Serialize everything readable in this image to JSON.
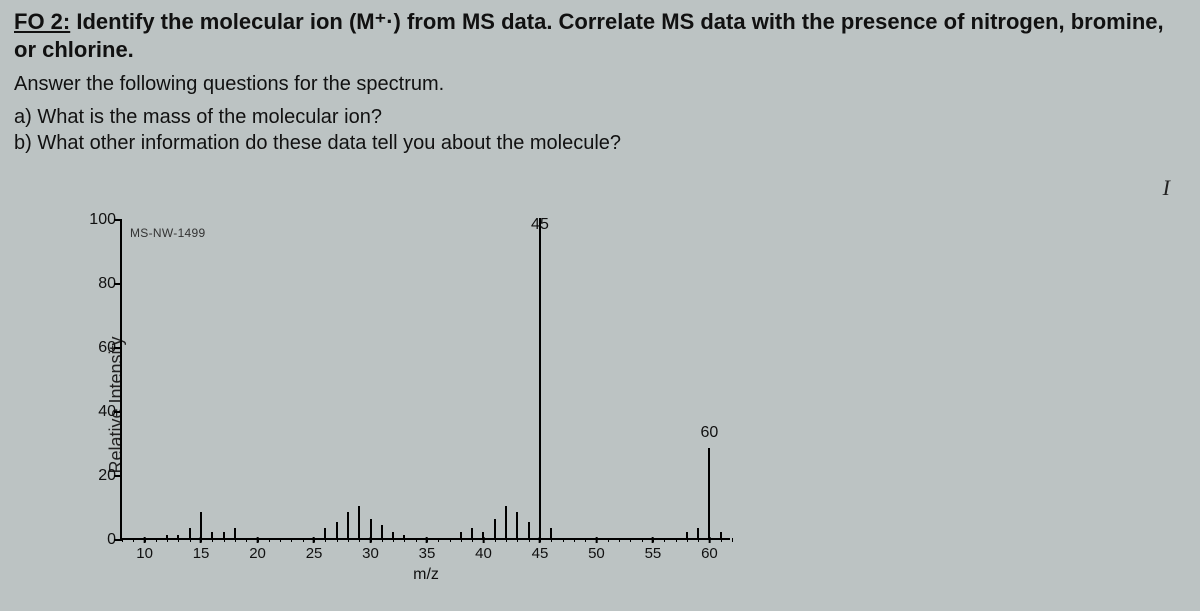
{
  "heading": {
    "fo_label": "FO 2:",
    "fo_rest": " Identify the molecular ion (M⁺·) from MS data. Correlate MS data with the presence of nitrogen, bromine, or chlorine."
  },
  "instructions": {
    "line1": "Answer the following questions for the spectrum.",
    "qa": "a) What is the mass of the molecular ion?",
    "qb": "b) What other information do these data tell you about the molecule?"
  },
  "cursor": "I",
  "chart_data": {
    "type": "bar",
    "title": "",
    "spectrum_label": "MS-NW-1499",
    "xlabel": "m/z",
    "ylabel": "Relative Intensity",
    "xlim": [
      8,
      62
    ],
    "ylim": [
      0,
      100
    ],
    "xticks": [
      10,
      15,
      20,
      25,
      30,
      35,
      40,
      45,
      50,
      55,
      60
    ],
    "yticks": [
      0,
      20,
      40,
      60,
      80,
      100
    ],
    "peak_labels": [
      {
        "mz": 45,
        "label": "45",
        "y": 100
      },
      {
        "mz": 60,
        "label": "60",
        "y": 30
      }
    ],
    "peaks": [
      {
        "mz": 12,
        "intensity": 1
      },
      {
        "mz": 13,
        "intensity": 1
      },
      {
        "mz": 14,
        "intensity": 3
      },
      {
        "mz": 15,
        "intensity": 8
      },
      {
        "mz": 16,
        "intensity": 2
      },
      {
        "mz": 17,
        "intensity": 2
      },
      {
        "mz": 18,
        "intensity": 3
      },
      {
        "mz": 26,
        "intensity": 3
      },
      {
        "mz": 27,
        "intensity": 5
      },
      {
        "mz": 28,
        "intensity": 8
      },
      {
        "mz": 29,
        "intensity": 10
      },
      {
        "mz": 30,
        "intensity": 6
      },
      {
        "mz": 31,
        "intensity": 4
      },
      {
        "mz": 32,
        "intensity": 2
      },
      {
        "mz": 33,
        "intensity": 1
      },
      {
        "mz": 38,
        "intensity": 2
      },
      {
        "mz": 39,
        "intensity": 3
      },
      {
        "mz": 40,
        "intensity": 2
      },
      {
        "mz": 41,
        "intensity": 6
      },
      {
        "mz": 42,
        "intensity": 10
      },
      {
        "mz": 43,
        "intensity": 8
      },
      {
        "mz": 44,
        "intensity": 5
      },
      {
        "mz": 45,
        "intensity": 100
      },
      {
        "mz": 46,
        "intensity": 3
      },
      {
        "mz": 58,
        "intensity": 2
      },
      {
        "mz": 59,
        "intensity": 3
      },
      {
        "mz": 60,
        "intensity": 28
      },
      {
        "mz": 61,
        "intensity": 2
      }
    ]
  }
}
